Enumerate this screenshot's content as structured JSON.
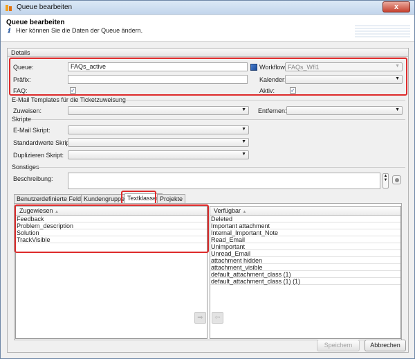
{
  "window": {
    "title": "Queue bearbeiten",
    "close_label": "x"
  },
  "header": {
    "title": "Queue bearbeiten",
    "info_icon": "ℹ",
    "subtitle": "Hier können Sie die Daten der Queue ändern."
  },
  "details": {
    "section_label": "Details",
    "queue_label": "Queue:",
    "queue_value": "FAQs_active",
    "praefix_label": "Präfix:",
    "praefix_value": "",
    "faq_label": "FAQ:",
    "faq_checked": true,
    "workflow_label": "Workflow:",
    "workflow_value": "FAQs_Wfl1",
    "kalender_label": "Kalender:",
    "kalender_value": "",
    "aktiv_label": "Aktiv:",
    "aktiv_checked": true
  },
  "email_templates": {
    "section_label": "E-Mail Templates für die Ticketzuweisung",
    "zuweisen_label": "Zuweisen:",
    "zuweisen_value": "",
    "entfernen_label": "Entfernen:",
    "entfernen_value": ""
  },
  "skripte": {
    "section_label": "Skripte",
    "email_label": "E-Mail Skript:",
    "standard_label": "Standardwerte Skript:",
    "duplizieren_label": "Duplizieren Skript:"
  },
  "sonstiges": {
    "section_label": "Sonstiges",
    "beschreibung_label": "Beschreibung:",
    "beschreibung_value": ""
  },
  "tabs": [
    {
      "label": "Benutzerdefinierte Felder"
    },
    {
      "label": "Kundengruppen"
    },
    {
      "label": "Textklassen"
    },
    {
      "label": "Projekte"
    }
  ],
  "active_tab": "Textklassen",
  "assigned": {
    "header": "Zugewiesen",
    "items": [
      "Feedback",
      "Problem_description",
      "Solution",
      "TrackVisible"
    ]
  },
  "available": {
    "header": "Verfügbar",
    "items": [
      "Deleted",
      "Important attachment",
      "Internal_Important_Note",
      "Read_Email",
      "Unimportant",
      "Unread_Email",
      "attachment hidden",
      "attachment_visible",
      "default_attachment_class (1)",
      "default_attachment_class (1) (1)"
    ]
  },
  "buttons": {
    "save": "Speichern",
    "cancel": "Abbrechen",
    "move_left": "⇦",
    "move_right": "➡"
  },
  "glyphs": {
    "sort_up": "▲",
    "dropdown": "▼",
    "check": "✓",
    "spin_up": "▲",
    "spin_down": "▼"
  },
  "colors": {
    "highlight": "#dd2a2a",
    "accent": "#2a5aa0"
  }
}
